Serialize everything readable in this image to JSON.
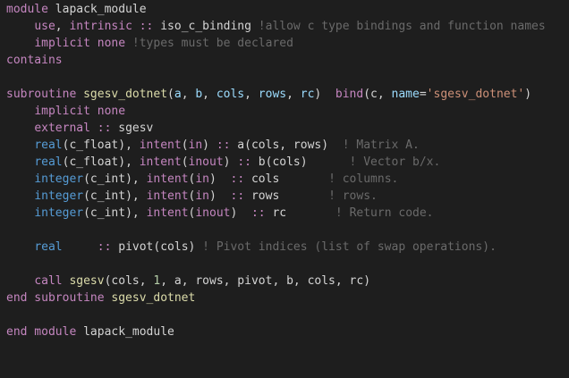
{
  "theme": {
    "background": "#1e1e1e",
    "keyword": "#c586c0",
    "function": "#dcdcaa",
    "type": "#569cd6",
    "identifier": "#9cdcfe",
    "plain": "#d4d4d4",
    "comment": "#6a6a6a",
    "number": "#b5cea8",
    "string": "#ce9178"
  },
  "lines": [
    [
      [
        "kw",
        "module"
      ],
      [
        "pl",
        " lapack_module"
      ]
    ],
    [
      [
        "pl",
        "    "
      ],
      [
        "kw",
        "use"
      ],
      [
        "pl",
        ", "
      ],
      [
        "kw",
        "intrinsic"
      ],
      [
        "pl",
        " "
      ],
      [
        "op",
        "::"
      ],
      [
        "pl",
        " iso_c_binding "
      ],
      [
        "cm",
        "!allow c type bindings and function names"
      ]
    ],
    [
      [
        "pl",
        "    "
      ],
      [
        "kw",
        "implicit none"
      ],
      [
        "pl",
        " "
      ],
      [
        "cm",
        "!types must be declared"
      ]
    ],
    [
      [
        "kw",
        "contains"
      ]
    ],
    [],
    [
      [
        "kw",
        "subroutine"
      ],
      [
        "pl",
        " "
      ],
      [
        "fn",
        "sgesv_dotnet"
      ],
      [
        "pl",
        "("
      ],
      [
        "id",
        "a"
      ],
      [
        "pl",
        ", "
      ],
      [
        "id",
        "b"
      ],
      [
        "pl",
        ", "
      ],
      [
        "id",
        "cols"
      ],
      [
        "pl",
        ", "
      ],
      [
        "id",
        "rows"
      ],
      [
        "pl",
        ", "
      ],
      [
        "id",
        "rc"
      ],
      [
        "pl",
        ")  "
      ],
      [
        "kw",
        "bind"
      ],
      [
        "pl",
        "(c, "
      ],
      [
        "id",
        "name"
      ],
      [
        "pl",
        "="
      ],
      [
        "str",
        "'sgesv_dotnet'"
      ],
      [
        "pl",
        ")"
      ]
    ],
    [
      [
        "pl",
        "    "
      ],
      [
        "kw",
        "implicit none"
      ]
    ],
    [
      [
        "pl",
        "    "
      ],
      [
        "kw",
        "external"
      ],
      [
        "pl",
        " "
      ],
      [
        "op",
        "::"
      ],
      [
        "pl",
        " sgesv"
      ]
    ],
    [
      [
        "pl",
        "    "
      ],
      [
        "ty",
        "real"
      ],
      [
        "pl",
        "(c_float), "
      ],
      [
        "kw",
        "intent"
      ],
      [
        "pl",
        "("
      ],
      [
        "kw",
        "in"
      ],
      [
        "pl",
        ") "
      ],
      [
        "op",
        "::"
      ],
      [
        "pl",
        " a(cols, rows)  "
      ],
      [
        "cm",
        "! Matrix A."
      ]
    ],
    [
      [
        "pl",
        "    "
      ],
      [
        "ty",
        "real"
      ],
      [
        "pl",
        "(c_float), "
      ],
      [
        "kw",
        "intent"
      ],
      [
        "pl",
        "("
      ],
      [
        "kw",
        "inout"
      ],
      [
        "pl",
        ") "
      ],
      [
        "op",
        "::"
      ],
      [
        "pl",
        " b(cols)      "
      ],
      [
        "cm",
        "! Vector b/x."
      ]
    ],
    [
      [
        "pl",
        "    "
      ],
      [
        "ty",
        "integer"
      ],
      [
        "pl",
        "(c_int), "
      ],
      [
        "kw",
        "intent"
      ],
      [
        "pl",
        "("
      ],
      [
        "kw",
        "in"
      ],
      [
        "pl",
        ")  "
      ],
      [
        "op",
        "::"
      ],
      [
        "pl",
        " cols       "
      ],
      [
        "cm",
        "! columns."
      ]
    ],
    [
      [
        "pl",
        "    "
      ],
      [
        "ty",
        "integer"
      ],
      [
        "pl",
        "(c_int), "
      ],
      [
        "kw",
        "intent"
      ],
      [
        "pl",
        "("
      ],
      [
        "kw",
        "in"
      ],
      [
        "pl",
        ")  "
      ],
      [
        "op",
        "::"
      ],
      [
        "pl",
        " rows       "
      ],
      [
        "cm",
        "! rows."
      ]
    ],
    [
      [
        "pl",
        "    "
      ],
      [
        "ty",
        "integer"
      ],
      [
        "pl",
        "(c_int), "
      ],
      [
        "kw",
        "intent"
      ],
      [
        "pl",
        "("
      ],
      [
        "kw",
        "inout"
      ],
      [
        "pl",
        ")  "
      ],
      [
        "op",
        "::"
      ],
      [
        "pl",
        " rc       "
      ],
      [
        "cm",
        "! Return code."
      ]
    ],
    [],
    [
      [
        "pl",
        "    "
      ],
      [
        "ty",
        "real"
      ],
      [
        "pl",
        "     "
      ],
      [
        "op",
        "::"
      ],
      [
        "pl",
        " pivot(cols) "
      ],
      [
        "cm",
        "! Pivot indices (list of swap operations)."
      ]
    ],
    [],
    [
      [
        "pl",
        "    "
      ],
      [
        "kw",
        "call"
      ],
      [
        "pl",
        " "
      ],
      [
        "fn",
        "sgesv"
      ],
      [
        "pl",
        "(cols, "
      ],
      [
        "num",
        "1"
      ],
      [
        "pl",
        ", a, rows, pivot, b, cols, rc)"
      ]
    ],
    [
      [
        "kw",
        "end subroutine"
      ],
      [
        "pl",
        " "
      ],
      [
        "fn",
        "sgesv_dotnet"
      ]
    ],
    [],
    [
      [
        "kw",
        "end module"
      ],
      [
        "pl",
        " lapack_module"
      ]
    ]
  ]
}
